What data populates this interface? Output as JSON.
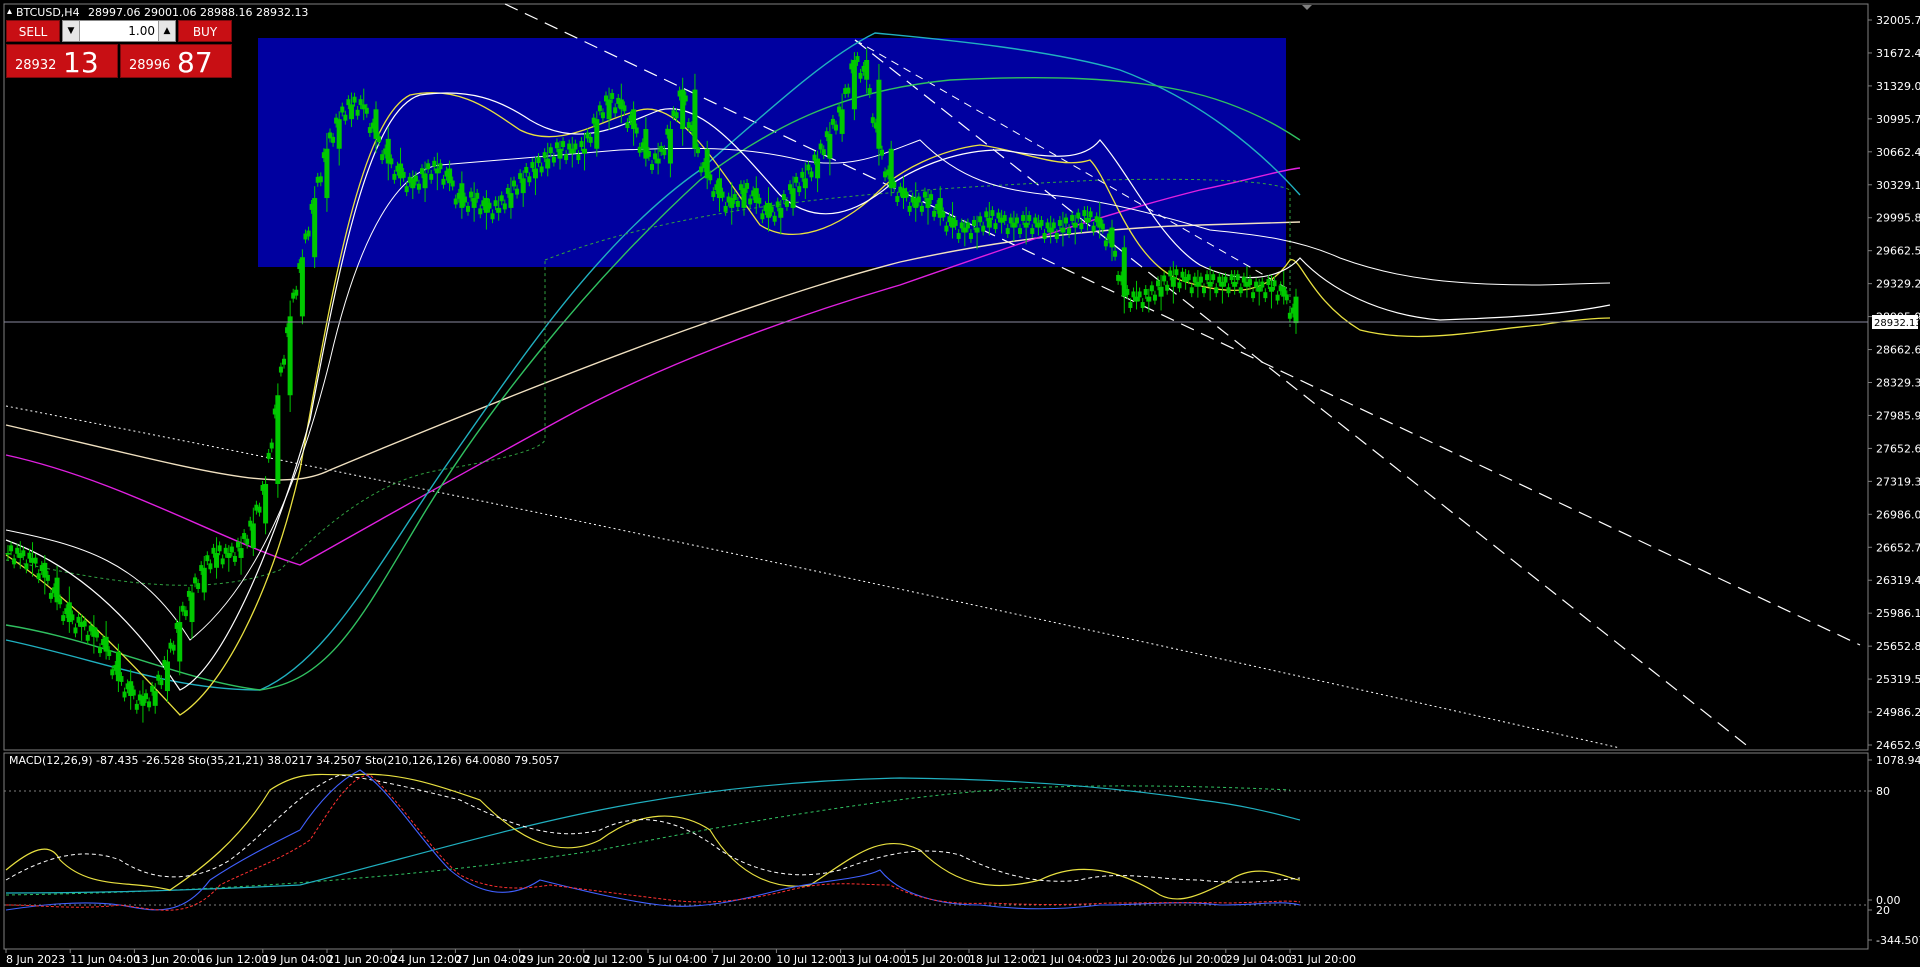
{
  "window": {
    "symbol_line": "BTCUSD,H4",
    "ohlc_line": "28997.06 29001.06 28988.16 28932.13"
  },
  "trade_panel": {
    "sell_label": "SELL",
    "buy_label": "BUY",
    "lot_value": "1.00",
    "sell_price_small": "28932",
    "sell_price_big": "13",
    "buy_price_small": "28996",
    "buy_price_big": "87"
  },
  "price_axis": {
    "labels": [
      "32005.70",
      "31672.40",
      "31329.00",
      "30995.70",
      "30662.40",
      "30329.10",
      "29995.80",
      "29662.50",
      "29329.20",
      "28995.90",
      "28662.60",
      "28329.30",
      "27985.90",
      "27652.60",
      "27319.30",
      "26986.00",
      "26652.70",
      "26319.40",
      "25986.10",
      "25652.80",
      "25319.50",
      "24986.20",
      "24652.90"
    ],
    "current_price": "28932.13",
    "max": 32005.7,
    "min": 24652.9
  },
  "indicator_axis": {
    "labels": [
      "1078.946",
      "80",
      "0.00",
      "20",
      "-344.507"
    ]
  },
  "indicator_title": "MACD(12,26,9) -87.435 -26.528  Sto(35,21,21) 38.0217 34.2507  Sto(210,126,126) 64.0080 79.5057",
  "time_axis": {
    "labels": [
      "8 Jun 2023",
      "11 Jun 04:00",
      "13 Jun 20:00",
      "16 Jun 12:00",
      "19 Jun 04:00",
      "21 Jun 20:00",
      "24 Jun 12:00",
      "27 Jun 04:00",
      "29 Jun 20:00",
      "2 Jul 12:00",
      "5 Jul 04:00",
      "7 Jul 20:00",
      "10 Jul 12:00",
      "13 Jul 04:00",
      "15 Jul 20:00",
      "18 Jul 12:00",
      "21 Jul 04:00",
      "23 Jul 20:00",
      "26 Jul 20:00",
      "29 Jul 04:00",
      "31 Jul 20:00"
    ]
  },
  "colors": {
    "background": "#000000",
    "candles": "#00c800",
    "range_box": "#0000a0",
    "sell_buy": "#c80f14",
    "ma_magenta": "#e020e0",
    "ma_cyan": "#20b0c0",
    "ma_green": "#30c060",
    "ma_wheat": "#f0e0c0",
    "ma_yellow": "#e8e040",
    "macd_blue": "#4060ff",
    "signal_red": "#ff3030"
  },
  "chart_data": {
    "type": "line",
    "title": "BTCUSD,H4",
    "x_labels": [
      "8 Jun 2023",
      "11 Jun 04:00",
      "13 Jun 20:00",
      "16 Jun 12:00",
      "19 Jun 04:00",
      "21 Jun 20:00",
      "24 Jun 12:00",
      "27 Jun 04:00",
      "29 Jun 20:00",
      "2 Jul 12:00",
      "5 Jul 04:00",
      "7 Jul 20:00",
      "10 Jul 12:00",
      "13 Jul 04:00",
      "15 Jul 20:00",
      "18 Jul 12:00",
      "21 Jul 04:00",
      "23 Jul 20:00",
      "26 Jul 20:00",
      "29 Jul 04:00",
      "31 Jul 20:00"
    ],
    "ylim": [
      24652.9,
      32005.7
    ],
    "range_box": [
      29650,
      31850
    ],
    "series": [
      {
        "values": [
          26600,
          26550,
          26500,
          26350,
          26100,
          25900,
          25850,
          25750,
          25600,
          25300,
          25150,
          25050,
          25200,
          25500,
          25900,
          26200,
          26450,
          26600,
          26550,
          26650,
          26900,
          27300,
          28200,
          29000,
          29600,
          30200,
          30700,
          31000,
          31150,
          31100,
          30800,
          30550,
          30400,
          30300,
          30450,
          30500,
          30350,
          30100,
          30200,
          30050,
          30100,
          30250,
          30400,
          30500,
          30600,
          30700,
          30650,
          30700,
          31000,
          31200,
          31100,
          30900,
          30600,
          30550,
          30900,
          31300,
          30700,
          30400,
          30200,
          30100,
          30300,
          30150,
          30000,
          30100,
          30300,
          30400,
          30600,
          30850,
          31100,
          31600,
          31400,
          30700,
          30300,
          30200,
          30100,
          30200,
          30000,
          29900,
          29850,
          29900,
          30000,
          29950,
          29900,
          29950,
          29900,
          29850,
          29900,
          29950,
          30000,
          29900,
          29700,
          29200,
          29150,
          29200,
          29300,
          29400,
          29350,
          29300,
          29350,
          29300,
          29350,
          29300,
          29250,
          29300,
          29200,
          28932
        ]
      }
    ],
    "indicators": [
      {
        "name": "MACD(12,26,9)",
        "values": [
          -87.435,
          -26.528
        ]
      },
      {
        "name": "Sto(35,21,21)",
        "values": [
          38.0217,
          34.2507
        ]
      },
      {
        "name": "Sto(210,126,126)",
        "values": [
          64.008,
          79.5057
        ]
      }
    ]
  }
}
